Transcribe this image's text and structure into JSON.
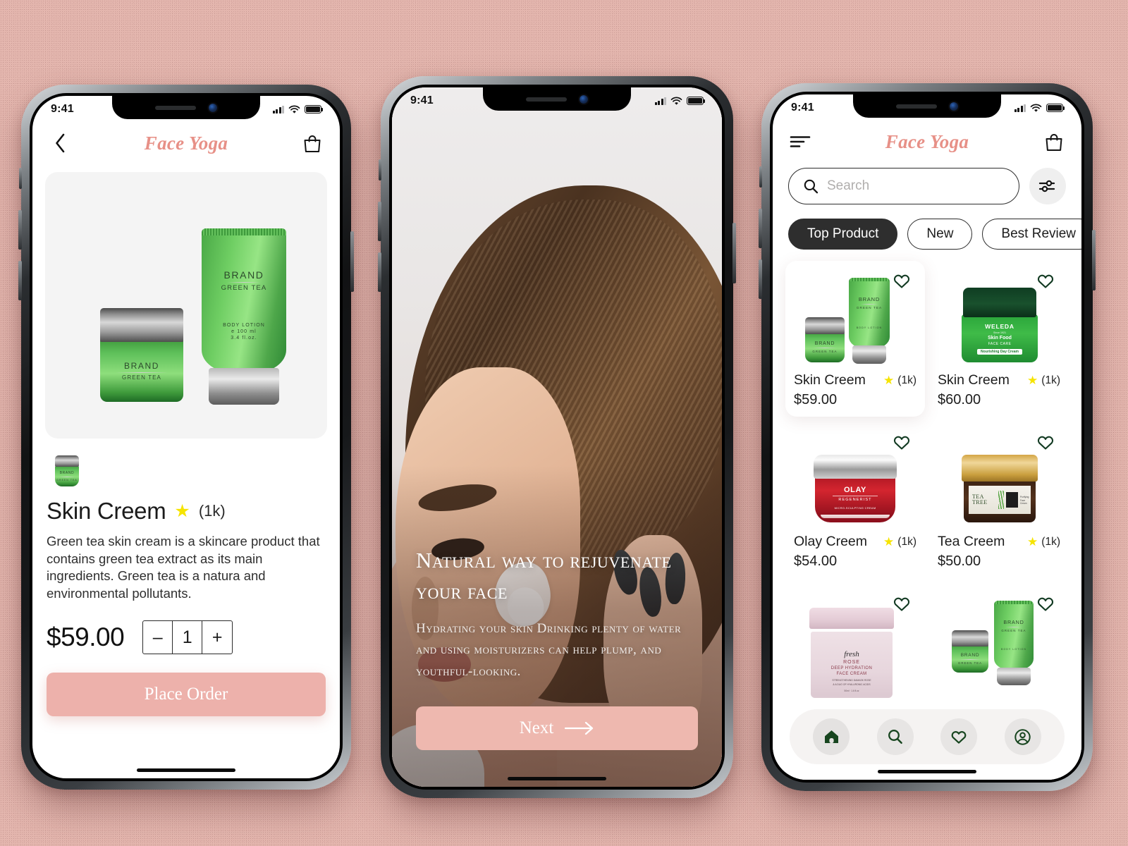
{
  "background": {
    "color": "#e3b5ad"
  },
  "theme": {
    "accent_pink": "#e79087",
    "button_pink": "#edb1ab",
    "dark": "#2e2e2e",
    "star_yellow": "#f6e400"
  },
  "status_bar": {
    "time": "9:41",
    "signal_icon": "cellular-bars-icon",
    "wifi_icon": "wifi-icon",
    "battery_icon": "battery-icon"
  },
  "phone1": {
    "header": {
      "back_icon": "chevron-left-icon",
      "title": "Face Yoga",
      "cart_icon": "shopping-bag-icon"
    },
    "hero": {
      "jar": {
        "brand": "BRAND",
        "variant": "GREEN TEA"
      },
      "tube": {
        "brand": "BRAND",
        "variant": "GREEN TEA",
        "type": "BODY LOTION",
        "volume": "e 100 ml",
        "volume_oz": "3.4 fl.oz."
      }
    },
    "thumbnail": {
      "brand": "BRAND",
      "variant": "GREEN TEA"
    },
    "product": {
      "name": "Skin Creem",
      "star_icon": "star-icon",
      "rating_count": "(1k)",
      "description": "Green tea skin cream is a skincare product that contains green tea extract as its main ingredients. Green tea is a natura and environmental pollutants.",
      "price": "$59.00",
      "quantity": "1",
      "minus_label": "–",
      "plus_label": "+"
    },
    "cta": {
      "label": "Place Order"
    }
  },
  "phone2": {
    "heading": "Natural way to rejuvenate your face",
    "subheading": "Hydrating your skin Drinking plenty of water and using moisturizers can help plump, and youthful-looking.",
    "cta": {
      "label": "Next",
      "arrow_icon": "arrow-right-icon"
    }
  },
  "phone3": {
    "header": {
      "menu_icon": "hamburger-menu-icon",
      "title": "Face Yoga",
      "cart_icon": "shopping-bag-icon"
    },
    "search": {
      "placeholder": "Search",
      "value": "",
      "search_icon": "search-icon"
    },
    "filter_button": {
      "icon": "sliders-filter-icon"
    },
    "chips": [
      {
        "label": "Top Product",
        "active": true
      },
      {
        "label": "New",
        "active": false
      },
      {
        "label": "Best Review",
        "active": false
      },
      {
        "label": "",
        "active": false
      }
    ],
    "products": [
      {
        "name": "Skin Creem",
        "price": "$59.00",
        "rating_count": "(1k)",
        "star_icon": "star-icon",
        "heart_icon": "heart-outline-icon",
        "selected": true,
        "art": "brand-duo",
        "labels": {
          "brand": "BRAND",
          "variant": "GREEN TEA",
          "type": "BODY LOTION"
        }
      },
      {
        "name": "Skin Creem",
        "price": "$60.00",
        "rating_count": "(1k)",
        "star_icon": "star-icon",
        "heart_icon": "heart-outline-icon",
        "selected": false,
        "art": "weleda",
        "labels": {
          "brand": "WELEDA",
          "since": "Since 1921",
          "line1": "Skin Food",
          "line2": "FACE CARE",
          "badge": "Nourishing Day Cream"
        }
      },
      {
        "name": "Olay Creem",
        "price": "$54.00",
        "rating_count": "(1k)",
        "star_icon": "star-icon",
        "heart_icon": "heart-outline-icon",
        "selected": false,
        "art": "olay",
        "labels": {
          "brand": "OLAY",
          "line1": "REGENERIST",
          "line2": "MICRO-SCULPTING CREAM"
        }
      },
      {
        "name": "Tea Creem",
        "price": "$50.00",
        "rating_count": "(1k)",
        "star_icon": "star-icon",
        "heart_icon": "heart-outline-icon",
        "selected": false,
        "art": "teatree",
        "labels": {
          "brand": "TEA TREE",
          "line1": "Purifying",
          "line2": "Face Cream"
        }
      },
      {
        "name": "",
        "price": "",
        "rating_count": "",
        "star_icon": "star-icon",
        "heart_icon": "heart-outline-icon",
        "selected": false,
        "art": "fresh",
        "labels": {
          "brand": "fresh",
          "line1": "ROSE",
          "line2": "DEEP HYDRATION",
          "line3": "FACE CREAM",
          "line4": "STRENGTHENING DAMASK ROSE",
          "line5": "& A DUO OF HYALURONIC ACIDS",
          "line6": "50ml · 1.6 fl.oz"
        }
      },
      {
        "name": "",
        "price": "",
        "rating_count": "",
        "star_icon": "star-icon",
        "heart_icon": "heart-outline-icon",
        "selected": false,
        "art": "brand-duo",
        "labels": {
          "brand": "BRAND",
          "variant": "GREEN TEA",
          "type": "BODY LOTION"
        }
      }
    ],
    "tabbar": [
      {
        "icon": "home-icon",
        "active": true
      },
      {
        "icon": "search-icon",
        "active": false
      },
      {
        "icon": "heart-outline-icon",
        "active": false
      },
      {
        "icon": "user-account-icon",
        "active": false
      }
    ]
  }
}
